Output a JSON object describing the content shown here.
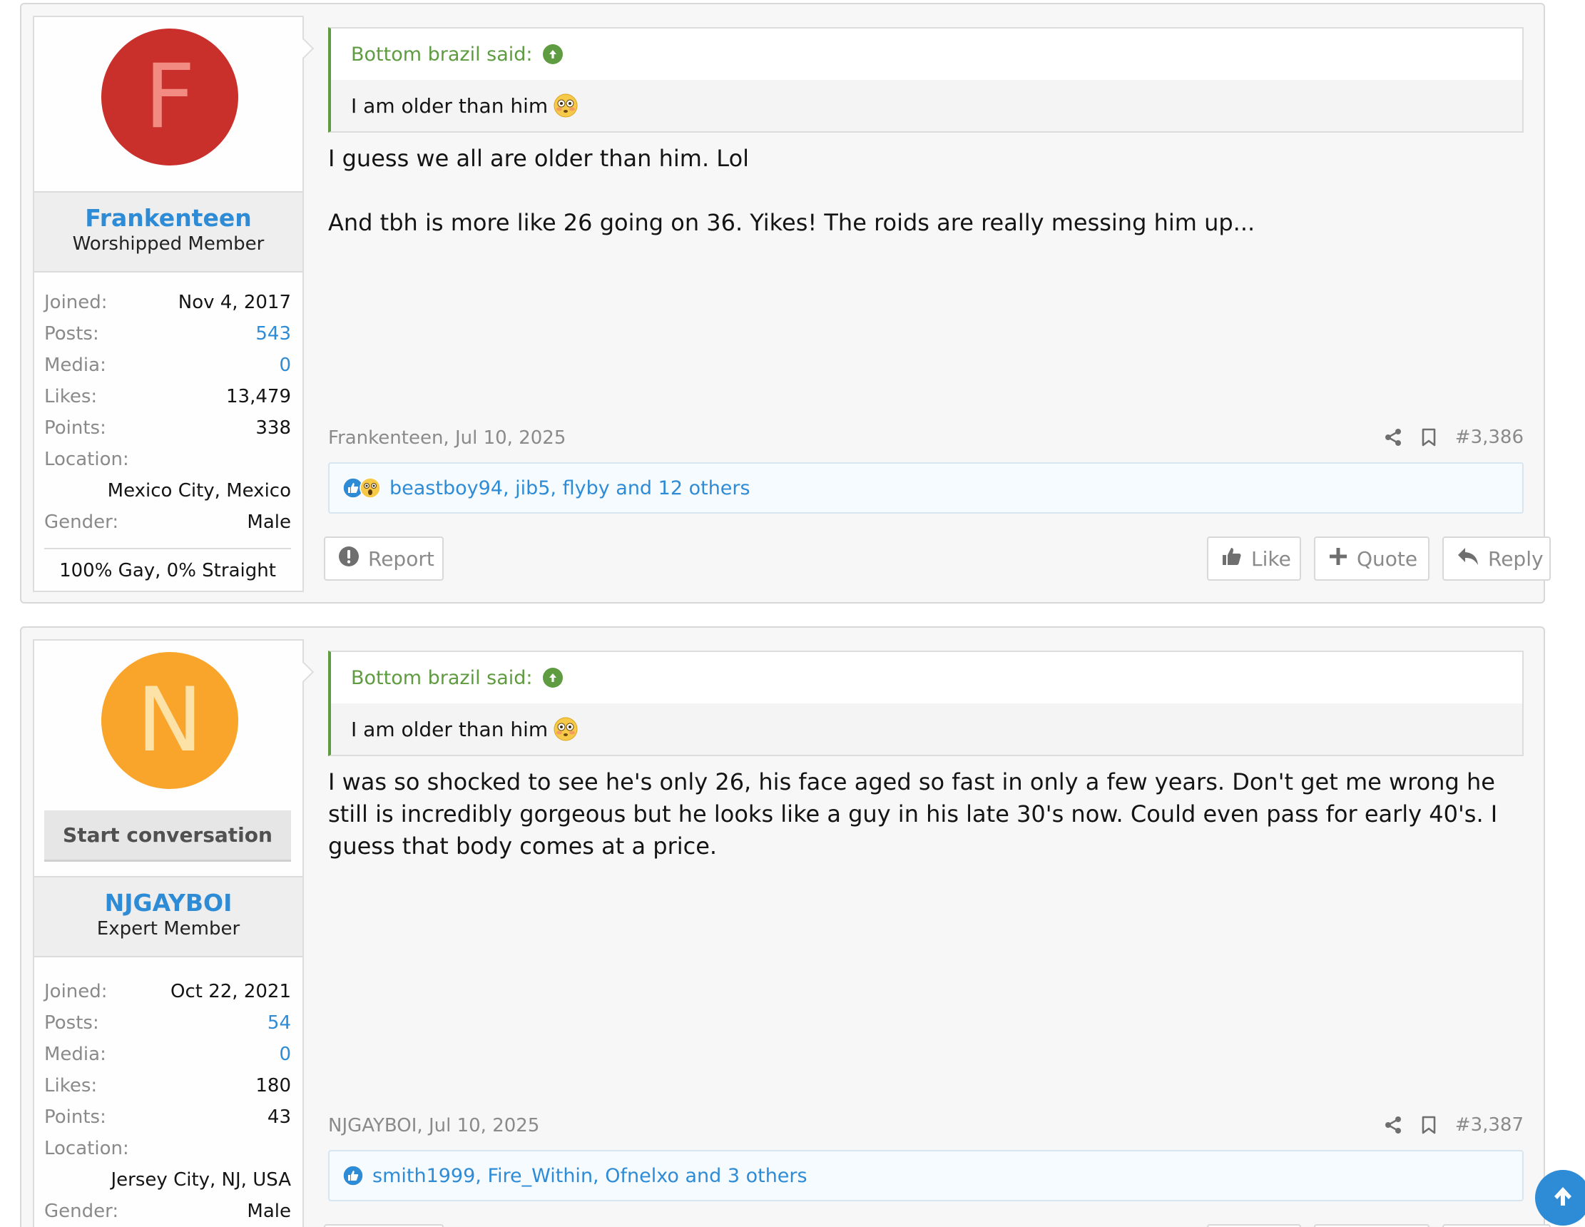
{
  "posts": [
    {
      "avatar_letter": "F",
      "avatar_bg": "#c9302c",
      "avatar_fg": "#f28b82",
      "username": "Frankenteen",
      "user_title": "Worshipped Member",
      "stats": [
        {
          "label": "Joined:",
          "value": "Nov 4, 2017",
          "link": false
        },
        {
          "label": "Posts:",
          "value": "543",
          "link": true
        },
        {
          "label": "Media:",
          "value": "0",
          "link": true
        },
        {
          "label": "Likes:",
          "value": "13,479",
          "link": false
        },
        {
          "label": "Points:",
          "value": "338",
          "link": false
        }
      ],
      "location_label": "Location:",
      "location_value": "Mexico City, Mexico",
      "gender_label": "Gender:",
      "gender_value": "Male",
      "custom_field": "100% Gay, 0% Straight",
      "quote_author": "Bottom brazil said:",
      "quote_text": "I am older than him",
      "message": [
        "I guess we all are older than him. Lol",
        "And tbh is more like 26 going on 36. Yikes! The roids are really messing him up..."
      ],
      "meta_author": "Frankenteen, Jul 10, 2025",
      "post_number": "#3,386",
      "reactions_text": "beastboy94, jib5, flyby and 12 others",
      "reaction_icons": [
        "like-reaction-icon",
        "wow-reaction-icon"
      ],
      "report_label": "Report",
      "like_label": "Like",
      "quote_label": "Quote",
      "reply_label": "Reply"
    },
    {
      "avatar_letter": "N",
      "avatar_bg": "#f9a52b",
      "avatar_fg": "#fde2a8",
      "start_conversation": "Start conversation",
      "username": "NJGAYBOI",
      "user_title": "Expert Member",
      "stats": [
        {
          "label": "Joined:",
          "value": "Oct 22, 2021",
          "link": false
        },
        {
          "label": "Posts:",
          "value": "54",
          "link": true
        },
        {
          "label": "Media:",
          "value": "0",
          "link": true
        },
        {
          "label": "Likes:",
          "value": "180",
          "link": false
        },
        {
          "label": "Points:",
          "value": "43",
          "link": false
        }
      ],
      "location_label": "Location:",
      "location_value": "Jersey City, NJ, USA",
      "gender_label": "Gender:",
      "gender_value": "Male",
      "quote_author": "Bottom brazil said:",
      "quote_text": "I am older than him",
      "message": [
        "I was so shocked to see he's only 26, his face aged so fast in only a few years. Don't get me wrong he still is incredibly gorgeous but he looks like a guy in his late 30's now. Could even pass for early 40's. I guess that body comes at a price."
      ],
      "meta_author": "NJGAYBOI, Jul 10, 2025",
      "post_number": "#3,387",
      "reactions_text": "smith1999, Fire_Within, Ofnelxo and 3 others",
      "reaction_icons": [
        "like-reaction-icon"
      ]
    }
  ],
  "colors": {
    "link": "#2e8bd5",
    "quote_accent": "#5e9b41",
    "muted": "#8a8a8a"
  }
}
